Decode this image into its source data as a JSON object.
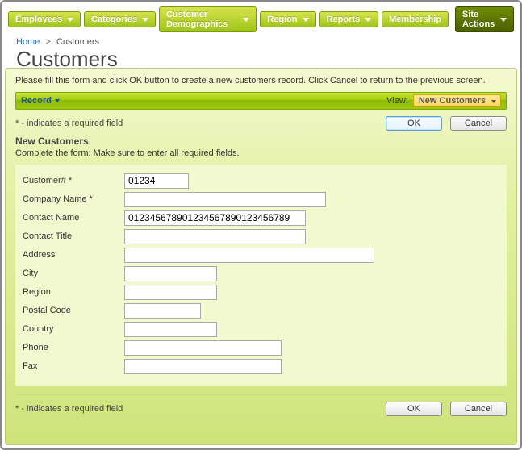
{
  "nav": {
    "items": [
      {
        "label": "Employees"
      },
      {
        "label": "Categories"
      },
      {
        "label": "Customer Demographics"
      },
      {
        "label": "Region"
      },
      {
        "label": "Reports"
      },
      {
        "label": "Membership"
      }
    ],
    "site_actions": "Site Actions"
  },
  "breadcrumb": {
    "home": "Home",
    "current": "Customers"
  },
  "page_title": "Customers",
  "instructions": "Please fill this form and click OK button to create a new customers record. Click Cancel to return to the previous screen.",
  "record_menu": "Record",
  "view_label": "View:",
  "view_value": "New Customers",
  "required_note": "* - indicates a required field",
  "section_title": "New Customers",
  "section_sub": "Complete the form. Make sure to enter all required fields.",
  "buttons": {
    "ok": "OK",
    "cancel": "Cancel"
  },
  "fields": {
    "customer_id": {
      "label": "Customer# *",
      "value": "01234"
    },
    "company": {
      "label": "Company Name *",
      "value": ""
    },
    "contact": {
      "label": "Contact Name",
      "value": "012345678901234567890123456789"
    },
    "title": {
      "label": "Contact Title",
      "value": ""
    },
    "address": {
      "label": "Address",
      "value": ""
    },
    "city": {
      "label": "City",
      "value": ""
    },
    "region": {
      "label": "Region",
      "value": ""
    },
    "postal": {
      "label": "Postal Code",
      "value": ""
    },
    "country": {
      "label": "Country",
      "value": ""
    },
    "phone": {
      "label": "Phone",
      "value": ""
    },
    "fax": {
      "label": "Fax",
      "value": ""
    }
  }
}
